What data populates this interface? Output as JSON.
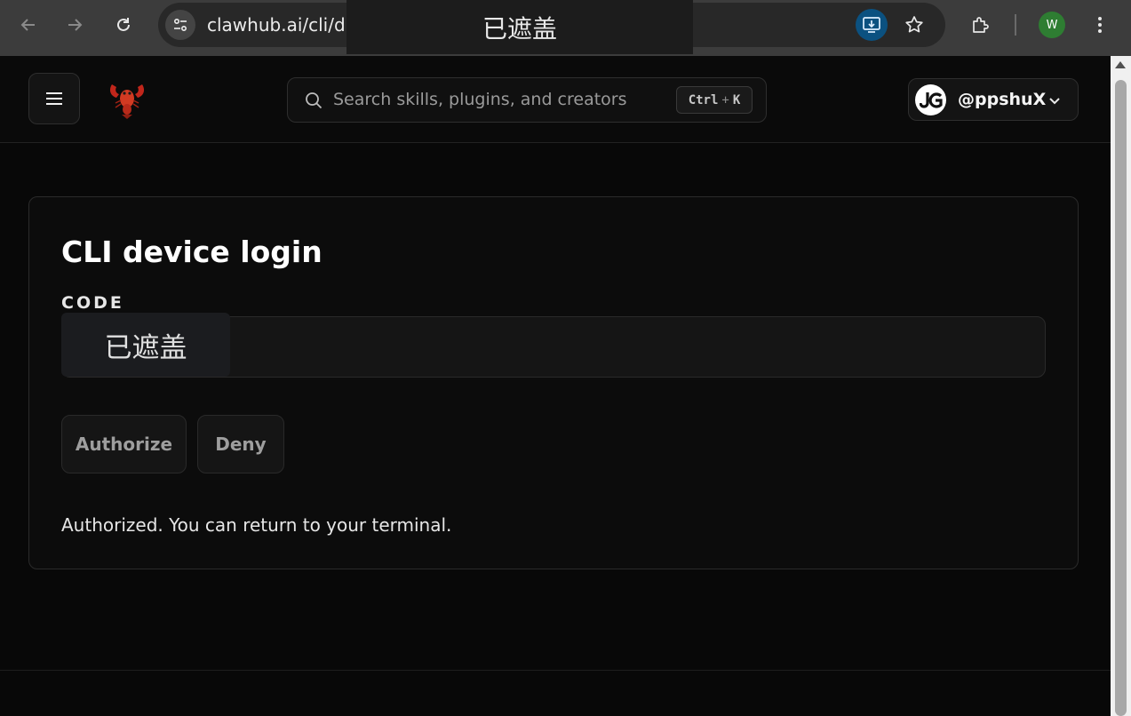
{
  "browser": {
    "url": "clawhub.ai/cli/d",
    "redaction_text": "已遮盖",
    "profile_initial": "W",
    "colors": {
      "install_button": "#0b5180",
      "profile": "#2e7d32"
    },
    "icons": [
      "back-arrow-icon",
      "forward-arrow-icon",
      "reload-icon",
      "site-settings-icon",
      "install-app-icon",
      "bookmark-star-icon",
      "extensions-puzzle-icon",
      "kebab-menu-icon"
    ]
  },
  "header": {
    "search_placeholder": "Search skills, plugins, and creators",
    "shortcut_ctrl": "Ctrl",
    "shortcut_plus": "+",
    "shortcut_key": "K",
    "username": "@ppshuX",
    "avatar_initials": "JG",
    "icons": [
      "menu-icon",
      "lobster-logo-icon",
      "search-icon",
      "chevron-down-icon"
    ]
  },
  "card": {
    "title": "CLI device login",
    "code_label": "CODE",
    "code_redaction": "已遮盖",
    "authorize_label": "Authorize",
    "deny_label": "Deny",
    "status_message": "Authorized. You can return to your terminal."
  }
}
